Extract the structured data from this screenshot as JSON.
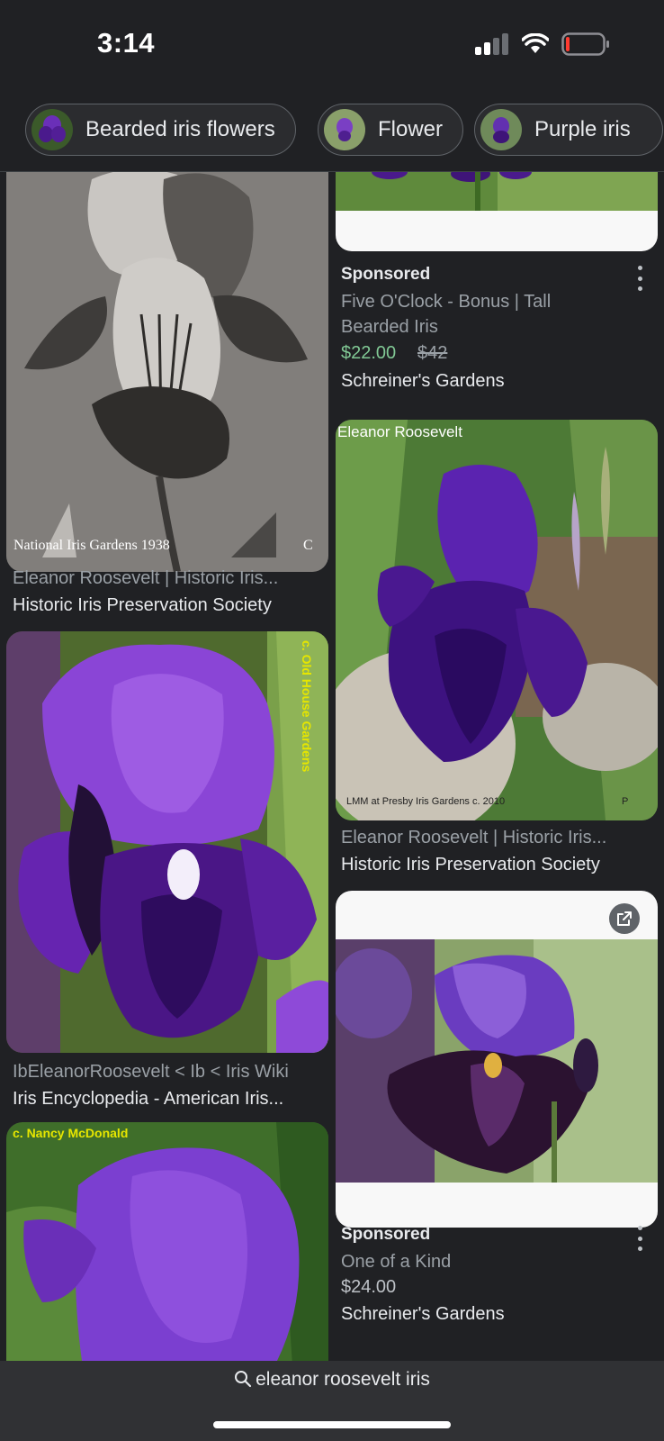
{
  "status_bar": {
    "time": "3:14"
  },
  "chips": [
    {
      "label": "Bearded iris flowers",
      "icon": "iris-thumbnail"
    },
    {
      "label": "Flower",
      "icon": "iris-thumbnail"
    },
    {
      "label": "Purple iris",
      "icon": "iris-thumbnail"
    }
  ],
  "results": {
    "left": [
      {
        "watermark_left": "National Iris Gardens 1938",
        "watermark_right": "C",
        "title": "Eleanor Roosevelt | Historic Iris...",
        "source": "Historic Iris Preservation Society"
      },
      {
        "watermark": "c. Old House Gardens",
        "title": "IbEleanorRoosevelt < Ib < Iris Wiki",
        "source": "Iris Encyclopedia - American Iris..."
      },
      {
        "watermark": "c. Nancy McDonald"
      }
    ],
    "right": [
      {
        "sponsored": "Sponsored",
        "title": "Five O'Clock - Bonus | Tall Bearded Iris",
        "price": "$22.00",
        "old_price": "$42",
        "merchant": "Schreiner's Gardens"
      },
      {
        "watermark_top": "Eleanor Roosevelt",
        "watermark_bottom": "LMM at Presby Iris Gardens c. 2010",
        "watermark_bottom_right": "P",
        "title": "Eleanor Roosevelt | Historic Iris...",
        "source": "Historic Iris Preservation Society"
      },
      {
        "sponsored": "Sponsored",
        "title": "One of a Kind",
        "price": "$24.00",
        "merchant": "Schreiner's Gardens"
      }
    ]
  },
  "search": {
    "query": "eleanor roosevelt iris"
  },
  "colors": {
    "background": "#202124",
    "price_sale": "#81c995",
    "iris_purple": "#5b1fa8"
  }
}
